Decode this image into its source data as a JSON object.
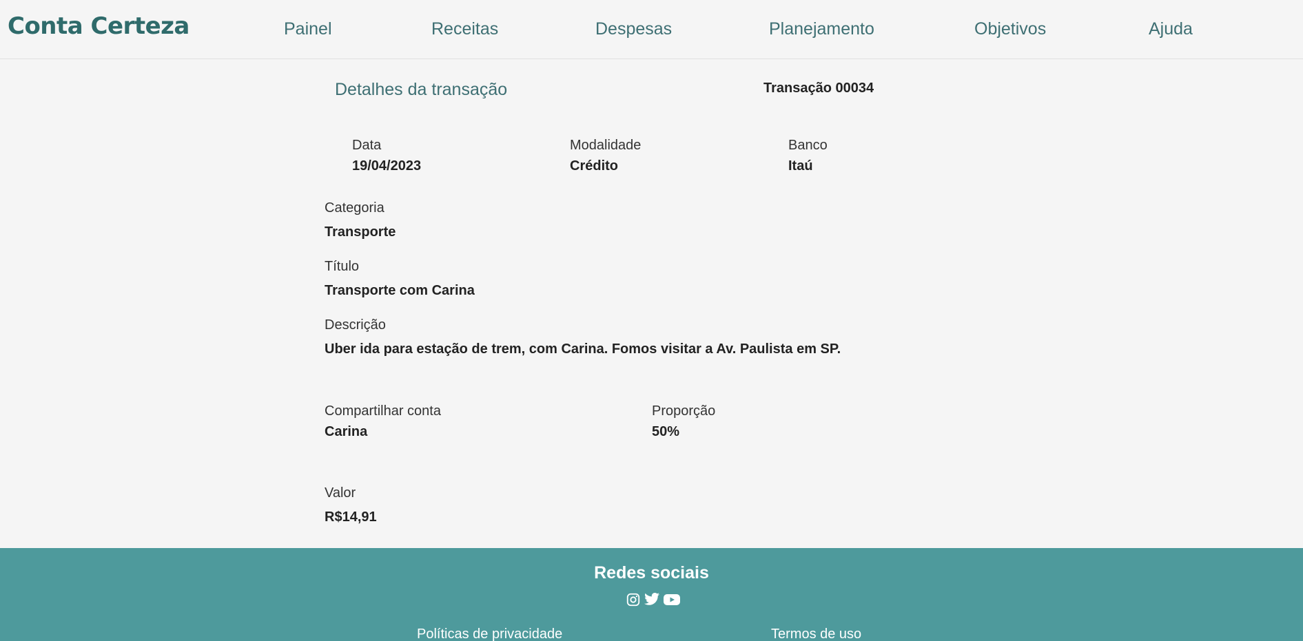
{
  "header": {
    "brand": "Conta Certeza",
    "nav": [
      "Painel",
      "Receitas",
      "Despesas",
      "Planejamento",
      "Objetivos",
      "Ajuda"
    ]
  },
  "details": {
    "section_title": "Detalhes da transação",
    "transaction_id": "Transação 00034",
    "date_label": "Data",
    "date_value": "19/04/2023",
    "mode_label": "Modalidade",
    "mode_value": "Crédito",
    "bank_label": "Banco",
    "bank_value": "Itaú",
    "category_label": "Categoria",
    "category_value": "Transporte",
    "title_label": "Título",
    "title_value": "Transporte com Carina",
    "description_label": "Descrição",
    "description_value": "Uber ida para estação de trem, com Carina. Fomos visitar a Av. Paulista em SP.",
    "share_label": "Compartilhar conta",
    "share_value": "Carina",
    "proportion_label": "Proporção",
    "proportion_value": "50%",
    "amount_label": "Valor",
    "amount_value": "R$14,91"
  },
  "footer": {
    "title": "Redes sociais",
    "social_icons": [
      "instagram-icon",
      "twitter-icon",
      "youtube-icon"
    ],
    "privacy_link": "Políticas de privacidade",
    "terms_link": "Termos de uso"
  },
  "colors": {
    "brand": "#2f6b6b",
    "nav_text": "#3e6f73",
    "footer_bg": "#4e9a9c",
    "page_bg": "#f5f5f5"
  }
}
